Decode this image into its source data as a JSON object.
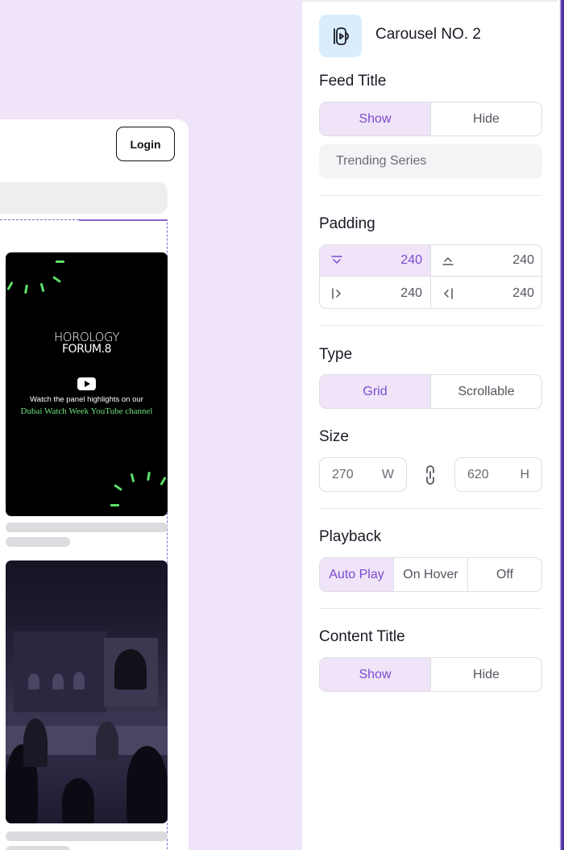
{
  "preview": {
    "login_label": "Login",
    "video1": {
      "brand_line1": "HOROLOGY",
      "brand_line2": "FORUM.8",
      "caption_line1": "Watch the panel highlights on our",
      "caption_line2": "Dubai Watch Week YouTube channel"
    }
  },
  "panel": {
    "carousel_icon": "video-library-icon",
    "carousel_title": "Carousel NO. 2",
    "feed_title": {
      "heading": "Feed Title",
      "options": [
        "Show",
        "Hide"
      ],
      "selected": "Show",
      "input_value": "Trending Series"
    },
    "padding": {
      "heading": "Padding",
      "bottom": "240",
      "top": "240",
      "right": "240",
      "left": "240"
    },
    "type": {
      "heading": "Type",
      "options": [
        "Grid",
        "Scrollable"
      ],
      "selected": "Grid"
    },
    "size": {
      "heading": "Size",
      "width": "270",
      "width_unit": "W",
      "height": "620",
      "height_unit": "H"
    },
    "playback": {
      "heading": "Playback",
      "options": [
        "Auto Play",
        "On Hover",
        "Off"
      ],
      "selected": "Auto Play"
    },
    "content_title": {
      "heading": "Content Title",
      "options": [
        "Show",
        "Hide"
      ],
      "selected": "Show"
    }
  },
  "colors": {
    "accent": "#7a4bd0",
    "accent_bg": "#efe4f8",
    "canvas_bg": "#efe4f8",
    "icon_tile_bg": "#d9edfc",
    "video_highlight": "#5ee06a"
  }
}
